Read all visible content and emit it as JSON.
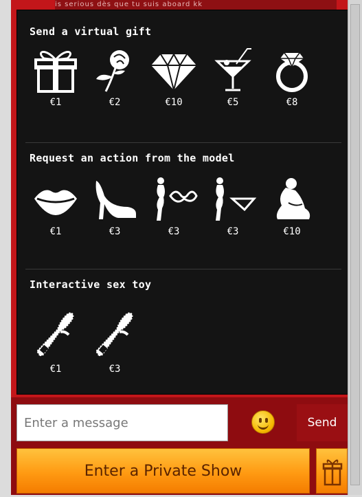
{
  "chat_top_text": "is serious dès que tu suis aboard kk",
  "sections": {
    "gifts": {
      "title": "Send a virtual gift",
      "items": [
        {
          "icon": "gift-box-icon",
          "price": "€1"
        },
        {
          "icon": "rose-icon",
          "price": "€2"
        },
        {
          "icon": "diamond-icon",
          "price": "€10"
        },
        {
          "icon": "cocktail-icon",
          "price": "€5"
        },
        {
          "icon": "ring-icon",
          "price": "€8"
        }
      ]
    },
    "actions": {
      "title": "Request an action from the model",
      "items": [
        {
          "icon": "lips-icon",
          "price": "€1"
        },
        {
          "icon": "high-heel-icon",
          "price": "€3"
        },
        {
          "icon": "remove-bra-icon",
          "price": "€3"
        },
        {
          "icon": "remove-panties-icon",
          "price": "€3"
        },
        {
          "icon": "pose-icon",
          "price": "€10"
        }
      ]
    },
    "toys": {
      "title": "Interactive sex toy",
      "items": [
        {
          "icon": "toy-low-icon",
          "price": "€1"
        },
        {
          "icon": "toy-high-icon",
          "price": "€3"
        }
      ]
    }
  },
  "message": {
    "placeholder": "Enter a message",
    "send_label": "Send"
  },
  "private_show_label": "Enter a Private Show",
  "colors": {
    "background": "#c3161a",
    "popup": "#141414",
    "button": "#ff9a12"
  }
}
